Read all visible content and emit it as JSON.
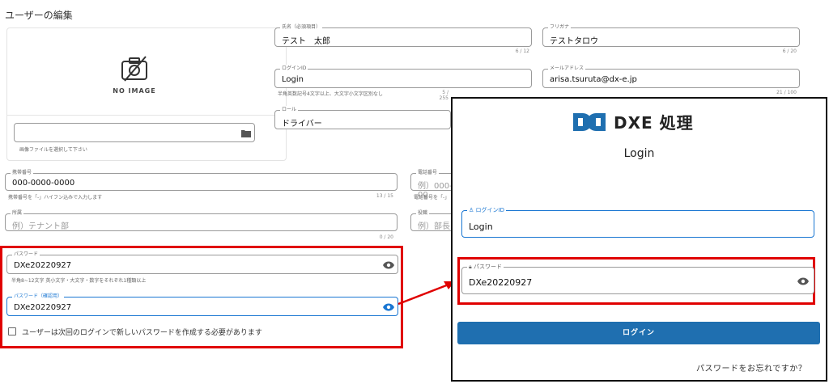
{
  "page": {
    "title": "ユーザーの編集"
  },
  "image_card": {
    "no_image": "NO IMAGE",
    "file_placeholder": "",
    "file_helper": "画像ファイルを選択して下さい"
  },
  "fields": {
    "name": {
      "label": "氏名（必須項目）",
      "value": "テスト　太郎",
      "counter": "6 / 12"
    },
    "furigana": {
      "label": "フリガナ",
      "value": "テストタロウ",
      "counter": "6 / 20"
    },
    "login_id": {
      "label": "ログインID",
      "value": "Login",
      "helper": "半角英数記号4文字以上、大文字小文字区別なし",
      "counter": "5 / 255"
    },
    "email": {
      "label": "メールアドレス",
      "value": "arisa.tsuruta@dx-e.jp",
      "counter": "21 / 100"
    },
    "role": {
      "label": "ロール",
      "value": "ドライバー"
    },
    "mobile": {
      "label": "携帯番号",
      "value": "000-0000-0000",
      "helper": "携帯番号を「-」ハイフン込みで入力します",
      "counter": "13 / 15"
    },
    "phone": {
      "label": "電話番号",
      "placeholder": "例）000-00",
      "helper": "電話番号を「-」"
    },
    "affiliation": {
      "label": "所属",
      "placeholder": "例）テナント部",
      "counter": "0 / 20"
    },
    "position": {
      "label": "役職",
      "placeholder": "例）部長"
    },
    "password": {
      "label": "パスワード",
      "value": "DXe20220927",
      "helper": "半角8~12文字 英小文字・大文字・数字をそれぞれ1種類以上"
    },
    "password_confirm": {
      "label": "パスワード（確認用）",
      "value": "DXe20220927"
    },
    "checkbox_label": "ユーザーは次回のログインで新しいパスワードを作成する必要があります"
  },
  "login": {
    "logo_text": "DXE 処理",
    "title": "Login",
    "login_id_label": "ログインID",
    "login_id_value": "Login",
    "password_label": "パスワード",
    "password_value": "DXe20220927",
    "button": "ログイン",
    "forgot": "パスワードをお忘れですか？"
  },
  "colors": {
    "accent": "#1f6fb0",
    "highlight": "#e00000",
    "focus_blue": "#1976d2"
  },
  "icons": [
    "no-image-icon",
    "folder-icon",
    "eye-icon",
    "user-icon",
    "lock-icon",
    "dxe-logo-icon",
    "arrow-icon"
  ]
}
